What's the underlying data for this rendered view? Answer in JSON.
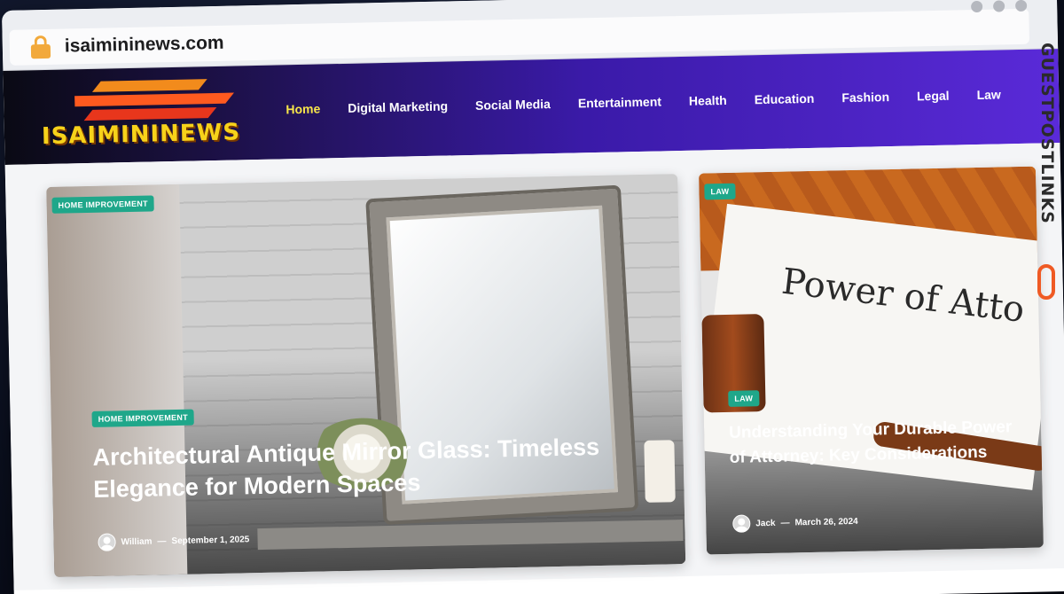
{
  "browser": {
    "url": "isaimininews.com"
  },
  "site": {
    "logo_text": "ISAIMININEWS",
    "nav": [
      {
        "label": "Home",
        "active": true
      },
      {
        "label": "Digital Marketing"
      },
      {
        "label": "Social Media"
      },
      {
        "label": "Entertainment"
      },
      {
        "label": "Health"
      },
      {
        "label": "Education"
      },
      {
        "label": "Fashion"
      },
      {
        "label": "Legal"
      },
      {
        "label": "Law"
      }
    ]
  },
  "featured": {
    "top_badge": "HOME IMPROVEMENT",
    "badge": "HOME IMPROVEMENT",
    "title": "Architectural Antique Mirror Glass: Timeless Elegance for Modern Spaces",
    "author": "William",
    "date": "September 1, 2025"
  },
  "side_post": {
    "top_badge": "LAW",
    "badge": "LAW",
    "image_text": "Power of Atto",
    "title": "Understanding Your Durable Power of Attorney: Key Considerations",
    "author": "Jack",
    "date": "March 26, 2024"
  },
  "watermark": "GUESTPOSTLINKS",
  "colors": {
    "accent_badge": "#1fa78a",
    "nav_active": "#f7e64a",
    "logo_yellow": "#f7d21a",
    "header_purple": "#5a2ad8"
  }
}
